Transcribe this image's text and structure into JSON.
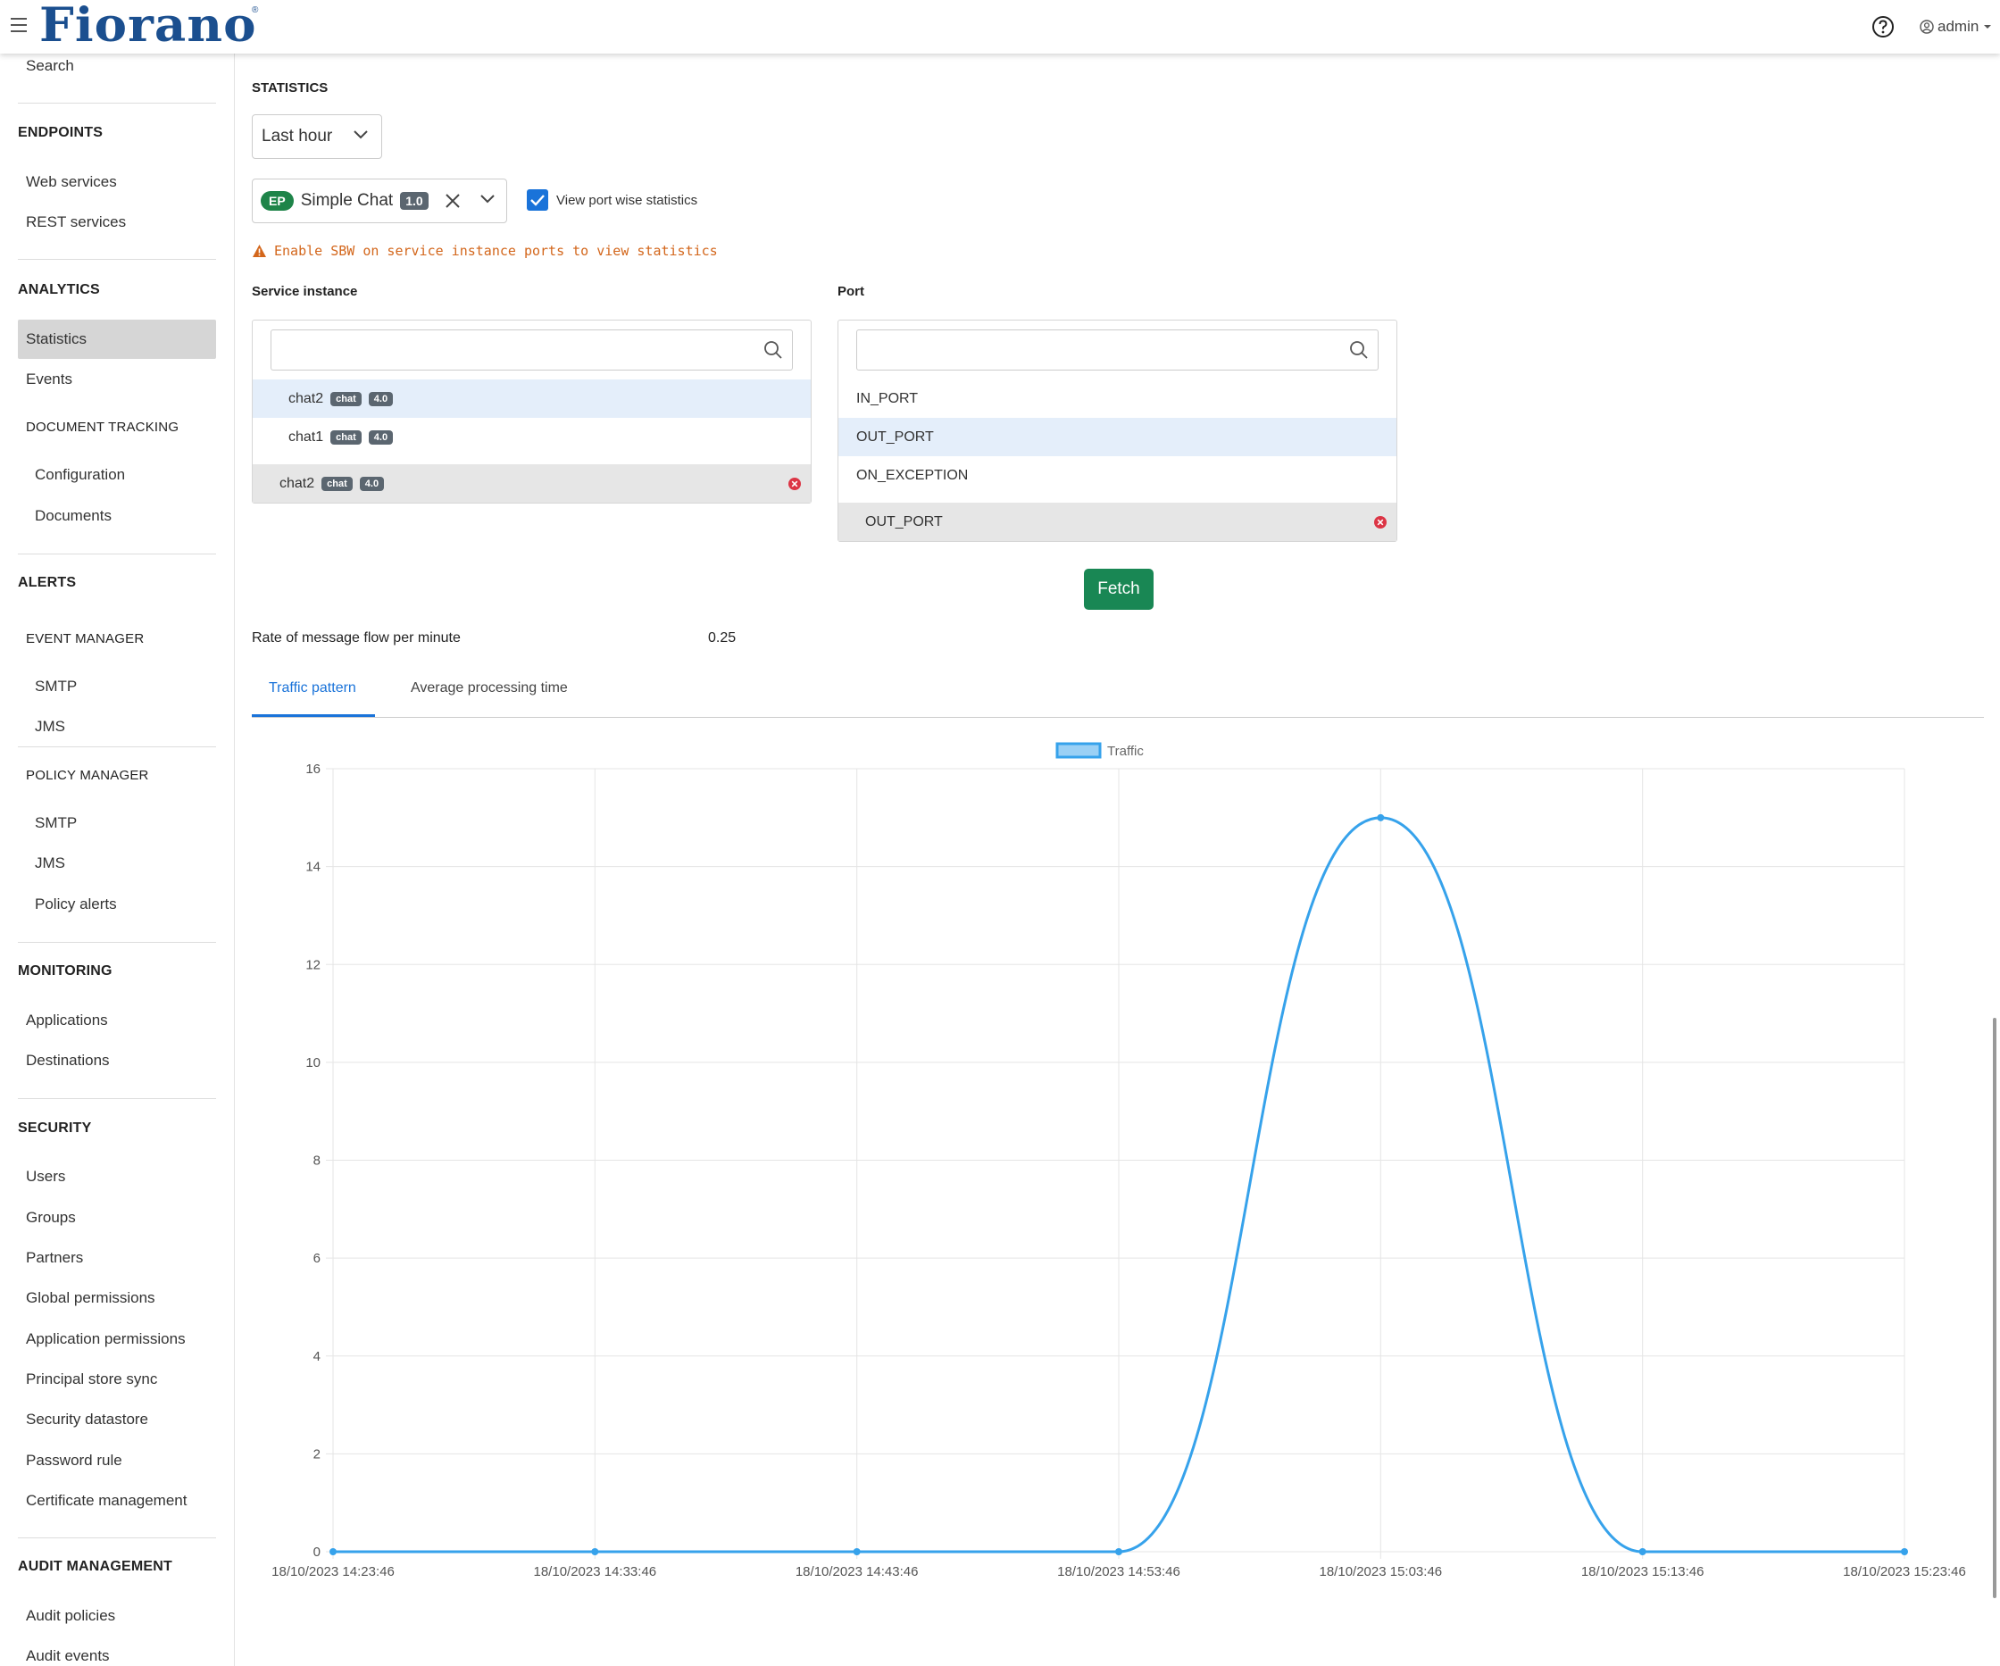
{
  "header": {
    "logo": "Fiorano",
    "logo_mark": "®",
    "user": "admin"
  },
  "sidebar": {
    "search": "Search",
    "endpoints": {
      "title": "ENDPOINTS",
      "items": [
        "Web services",
        "REST services"
      ]
    },
    "analytics": {
      "title": "ANALYTICS",
      "items": [
        "Statistics",
        "Events"
      ],
      "doc_tracking": "DOCUMENT TRACKING",
      "doc_items": [
        "Configuration",
        "Documents"
      ]
    },
    "alerts": {
      "title": "ALERTS",
      "event_manager": "EVENT MANAGER",
      "event_items": [
        "SMTP",
        "JMS"
      ],
      "policy_manager": "POLICY MANAGER",
      "policy_items": [
        "SMTP",
        "JMS",
        "Policy alerts"
      ]
    },
    "monitoring": {
      "title": "MONITORING",
      "items": [
        "Applications",
        "Destinations"
      ]
    },
    "security": {
      "title": "SECURITY",
      "items": [
        "Users",
        "Groups",
        "Partners",
        "Global permissions",
        "Application permissions",
        "Principal store sync",
        "Security datastore",
        "Password rule",
        "Certificate management"
      ]
    },
    "audit": {
      "title": "AUDIT MANAGEMENT",
      "items": [
        "Audit policies",
        "Audit events"
      ]
    }
  },
  "main": {
    "title": "STATISTICS",
    "time_range": "Last hour",
    "app": {
      "badge": "EP",
      "name": "Simple Chat",
      "version": "1.0"
    },
    "port_wise_label": "View port wise statistics",
    "port_wise_checked": true,
    "warning": "Enable SBW on service instance ports to view statistics",
    "service_instance": {
      "label": "Service instance",
      "options": [
        {
          "name": "chat2",
          "tag": "chat",
          "version": "4.0",
          "highlighted": true
        },
        {
          "name": "chat1",
          "tag": "chat",
          "version": "4.0",
          "highlighted": false
        }
      ],
      "selected": {
        "name": "chat2",
        "tag": "chat",
        "version": "4.0"
      }
    },
    "port": {
      "label": "Port",
      "options": [
        "IN_PORT",
        "OUT_PORT",
        "ON_EXCEPTION"
      ],
      "highlighted": "OUT_PORT",
      "selected": "OUT_PORT"
    },
    "fetch_label": "Fetch",
    "rate_label": "Rate of message flow per minute",
    "rate_value": "0.25",
    "tabs": [
      "Traffic pattern",
      "Average processing time"
    ],
    "active_tab": "Traffic pattern"
  },
  "chart_data": {
    "type": "line",
    "x": [
      "18/10/2023 14:23:46",
      "18/10/2023 14:33:46",
      "18/10/2023 14:43:46",
      "18/10/2023 14:53:46",
      "18/10/2023 15:03:46",
      "18/10/2023 15:13:46",
      "18/10/2023 15:23:46"
    ],
    "series": [
      {
        "name": "Traffic",
        "values": [
          0,
          0,
          0,
          0,
          15,
          0,
          0
        ],
        "color": "#36a2eb"
      }
    ],
    "ylim": [
      0,
      16
    ],
    "yticks": [
      0,
      2,
      4,
      6,
      8,
      10,
      12,
      14,
      16
    ],
    "grid": true,
    "legend": "top-center"
  }
}
